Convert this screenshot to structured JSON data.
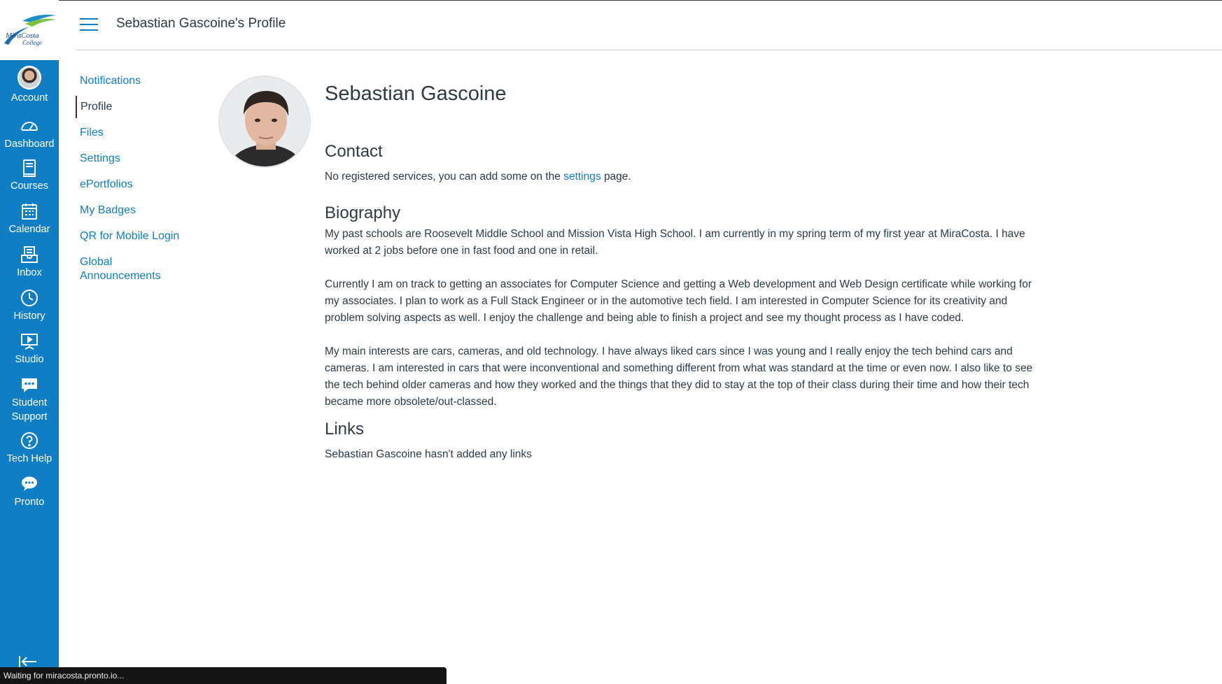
{
  "header": {
    "title": "Sebastian Gascoine's Profile"
  },
  "logo": {
    "text_line1": "MiraCosta",
    "text_line2": "College"
  },
  "global_nav": {
    "items": [
      {
        "label": "Account",
        "icon": "avatar"
      },
      {
        "label": "Dashboard",
        "icon": "dashboard-icon"
      },
      {
        "label": "Courses",
        "icon": "courses-icon"
      },
      {
        "label": "Calendar",
        "icon": "calendar-icon"
      },
      {
        "label": "Inbox",
        "icon": "inbox-icon"
      },
      {
        "label": "History",
        "icon": "history-icon"
      },
      {
        "label": "Studio",
        "icon": "studio-icon"
      },
      {
        "label": "Student Support",
        "icon": "chat-icon"
      },
      {
        "label": "Tech Help",
        "icon": "help-icon"
      },
      {
        "label": "Pronto",
        "icon": "pronto-icon"
      }
    ],
    "color": "#0f7ec4"
  },
  "section_nav": {
    "items": [
      {
        "label": "Notifications",
        "active": false
      },
      {
        "label": "Profile",
        "active": true
      },
      {
        "label": "Files",
        "active": false
      },
      {
        "label": "Settings",
        "active": false
      },
      {
        "label": "ePortfolios",
        "active": false
      },
      {
        "label": "My Badges",
        "active": false
      },
      {
        "label": "QR for Mobile Login",
        "active": false
      },
      {
        "label": "Global Announcements",
        "active": false
      }
    ]
  },
  "profile": {
    "name": "Sebastian Gascoine",
    "contact_heading": "Contact",
    "contact_text_before": "No registered services, you can add some on the",
    "contact_link": "settings",
    "contact_text_after": "page.",
    "bio_heading": "Biography",
    "bio_paragraphs": [
      "My past schools are Roosevelt Middle School and Mission Vista High School. I am currently in my spring term of my first year at MiraCosta. I have worked at 2 jobs before one in fast food and one in retail.",
      "Currently I am on track to getting an associates for Computer Science and getting a Web development and Web Design certificate while working for my associates. I plan to work as a Full Stack Engineer or in the automotive tech field. I am interested in Computer Science for its creativity and problem solving aspects as well. I enjoy the challenge and being able to finish a project and see my thought process as I have coded.",
      "My main interests are cars, cameras, and old technology. I have always liked cars since I was young and I really enjoy the tech behind cars and cameras. I am interested in cars that were inconventional and something different from what was standard at the time or even now. I also like to see the tech behind older cameras and how they worked and the things that they did to stay at the top of their class during their time and how their tech became more obsolete/out-classed."
    ],
    "links_heading": "Links",
    "links_text": "Sebastian Gascoine hasn't added any links"
  },
  "status_bar": {
    "text": "Waiting for miracosta.pronto.io..."
  }
}
